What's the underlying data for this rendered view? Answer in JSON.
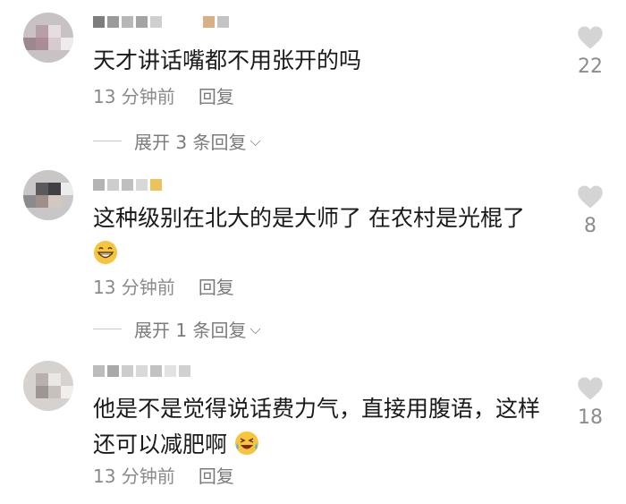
{
  "comments": [
    {
      "text": "天才讲话嘴都不用张开的吗",
      "time": "13 分钟前",
      "reply": "回复",
      "likes": "22",
      "expand": "展开 3 条回复"
    },
    {
      "text": "这种级别在北大的是大师了 在农村是光棍了",
      "time": "13 分钟前",
      "reply": "回复",
      "likes": "8",
      "expand": "展开 1 条回复"
    },
    {
      "text_line1": "他是不是觉得说话费力气，直接用腹语，这样",
      "text_line2": "还可以减肥啊",
      "time": "13 分钟前",
      "reply": "回复",
      "likes": "18"
    }
  ],
  "icons": {
    "like": "heart-icon",
    "expand": "chevron-down-icon",
    "emoji_grin": "grinning-emoji",
    "emoji_laugh": "laughing-tears-emoji"
  },
  "colors": {
    "text": "#1a1a1a",
    "meta": "#8a8a8a",
    "heart": "#d4d4d4"
  }
}
